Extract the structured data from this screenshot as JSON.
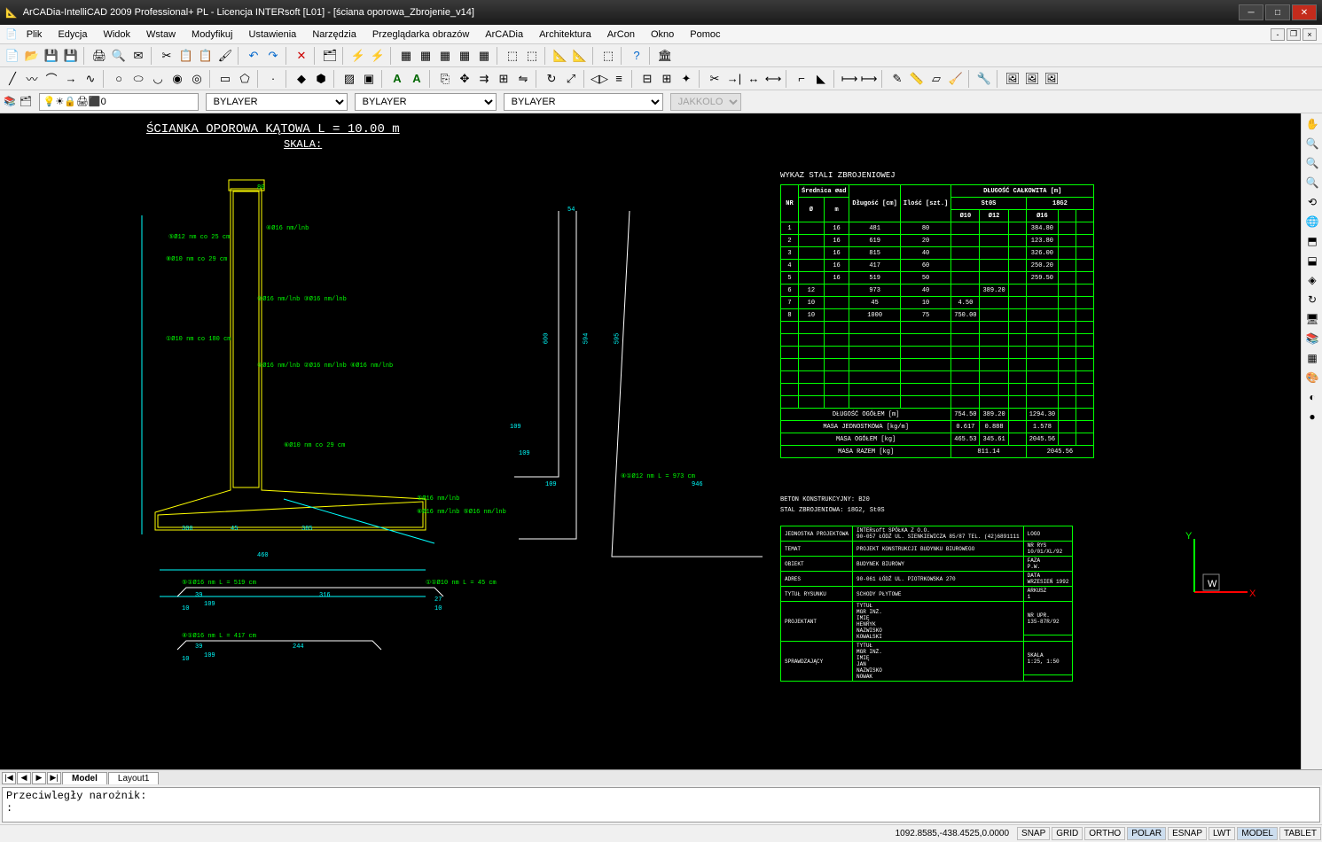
{
  "window": {
    "title": "ArCADia-IntelliCAD 2009 Professional+ PL - Licencja INTERsoft [L01] - [ściana oporowa_Zbrojenie_v14]"
  },
  "menu": [
    "Plik",
    "Edycja",
    "Widok",
    "Wstaw",
    "Modyfikuj",
    "Ustawienia",
    "Narzędzia",
    "Przeglądarka obrazów",
    "ArCADia",
    "Architektura",
    "ArCon",
    "Okno",
    "Pomoc"
  ],
  "layer": {
    "current": "0",
    "linetype": "BYLAYER",
    "lineweight": "BYLAYER",
    "style": "BYLAYER",
    "color_combo": "JAKKOLOR"
  },
  "drawing": {
    "title": "ŚCIANKA OPOROWA KĄTOWA L = 10.00 m",
    "subtitle": "SKALA:",
    "table_title": "WYKAZ STALI ZBROJENIOWEJ",
    "notes": [
      "BETON KONSTRUKCYJNY: B20",
      "STAL ZBROJENIOWA: 18G2, St0S"
    ],
    "annotations": {
      "a1": "④Ø16 nm/lnb",
      "a2": "⑤Ø12 nm co 25 cm",
      "a3": "⑧Ø10 nm co 29 cm",
      "a4": "②Ø16 nm/lnb  ③Ø16 nm/lnb",
      "a5": "①Ø10 nm co 180 cm",
      "a6": "①Ø16 nm/lnb ②Ø16 nm/lnb  ④Ø16 nm/lnb",
      "a7": "⑥Ø10 nm co 29 cm",
      "a8": "⑤Ø16 nm/lnb",
      "a9": "⑥Ø16 nm/lnb  ⑤Ø16 nm/lnb",
      "b1": "⑤①Ø16 nm  L = 519 cm",
      "b2": "④①Ø16 nm  L = 417 cm",
      "b3": "①①Ø10 nm  L = 45 cm",
      "b4": "④①Ø12 nm  L = 973 cm",
      "d1": "300",
      "d2": "45",
      "d3": "385",
      "d4": "460",
      "d5": "109",
      "d6": "10",
      "d7": "316",
      "d8": "39",
      "d9": "244",
      "d10": "600",
      "d11": "594",
      "d12": "595",
      "d13": "54",
      "d14": "946",
      "d15": "27",
      "d16": "80",
      "d17": "109"
    },
    "axes": {
      "y": "Y",
      "w": "W",
      "x": "X"
    }
  },
  "chart_data": {
    "type": "table",
    "title": "WYKAZ STALI ZBROJENIOWEJ",
    "columns": [
      "NR",
      "Średnica ∅ad",
      "Długość [cm]",
      "Ilość [szt.]",
      "St0S Ø10",
      "St0S Ø12",
      "18G2 Ø16",
      "DŁUGOŚĆ CAŁKOWITA [m]"
    ],
    "rows": [
      {
        "nr": "1",
        "dia": "16",
        "len": "481",
        "qty": "80",
        "s10": "",
        "s12": "",
        "g16": "",
        "total": "384.80"
      },
      {
        "nr": "2",
        "dia": "16",
        "len": "619",
        "qty": "20",
        "s10": "",
        "s12": "",
        "g16": "",
        "total": "123.80"
      },
      {
        "nr": "3",
        "dia": "16",
        "len": "815",
        "qty": "40",
        "s10": "",
        "s12": "",
        "g16": "",
        "total": "326.00"
      },
      {
        "nr": "4",
        "dia": "16",
        "len": "417",
        "qty": "60",
        "s10": "",
        "s12": "",
        "g16": "",
        "total": "250.20"
      },
      {
        "nr": "5",
        "dia": "16",
        "len": "519",
        "qty": "50",
        "s10": "",
        "s12": "",
        "g16": "",
        "total": "259.50"
      },
      {
        "nr": "6",
        "dia": "12",
        "len": "973",
        "qty": "40",
        "s10": "",
        "s12": "389.20",
        "g16": "",
        "total": ""
      },
      {
        "nr": "7",
        "dia": "10",
        "len": "45",
        "qty": "10",
        "s10": "4.50",
        "s12": "",
        "g16": "",
        "total": ""
      },
      {
        "nr": "8",
        "dia": "10",
        "len": "1000",
        "qty": "75",
        "s10": "750.00",
        "s12": "",
        "g16": "",
        "total": ""
      }
    ],
    "summary": {
      "dlugosc_ogolem": {
        "label": "DŁUGOŚĆ OGÓŁEM [m]",
        "s10": "754.50",
        "s12": "389.20",
        "g16": "",
        "total": "1294.30"
      },
      "masa_jednostkowa": {
        "label": "MASA JEDNOSTKOWA [kg/m]",
        "s10": "0.617",
        "s12": "0.888",
        "g16": "",
        "total": "1.578"
      },
      "masa_ogolem": {
        "label": "MASA OGÓŁEM [kg]",
        "s10": "465.53",
        "s12": "345.61",
        "g16": "",
        "total": "2045.56"
      },
      "masa_razem": {
        "label": "MASA RAZEM [kg]",
        "st0s": "811.14",
        "g18g2": "2045.56"
      }
    }
  },
  "title_block": {
    "jednostka": {
      "label": "JEDNOSTKA PROJEKTOWA",
      "val": "INTERsoft SPÓŁKA Z O.O.\n90-057 ŁÓDŹ UL. SIENKIEWICZA 85/87 TEL. (42)6891111",
      "logo": "LOGO"
    },
    "temat": {
      "label": "TEMAT",
      "val": "PROJEKT KONSTRUKCJI BUDYNKU BIUROWEGO",
      "nr": "NR RYS",
      "nrv": "10/01/XL/92"
    },
    "obiekt": {
      "label": "OBIEKT",
      "val": "BUDYNEK BIUROWY",
      "f": "FAZA",
      "fv": "P.W."
    },
    "adres": {
      "label": "ADRES",
      "val": "90-061 ŁÓDŹ UL. PIOTRKOWSKA 270",
      "d": "DATA",
      "dv": "WRZESIEŃ 1992"
    },
    "tytul": {
      "label": "TYTUŁ RYSUNKU",
      "val": "SCHODY PŁYTOWE",
      "a": "ARKUSZ",
      "av": "1"
    },
    "projektant": {
      "label": "PROJEKTANT",
      "t": "TYTUŁ\nMGR INŻ.\nIMIĘ\nHENRYK\nNAZWISKO\nKOWALSKI",
      "u": "NR UPR.",
      "uv": "135-87R/92"
    },
    "sprawdzajacy": {
      "label": "SPRAWDZAJĄCY",
      "t": "TYTUŁ\nMGR INŻ.\nIMIĘ\nJAN\nNAZWISKO\nNOWAK",
      "s": "SKALA",
      "sv": "1:25, 1:50"
    }
  },
  "tabs": {
    "model": "Model",
    "layout": "Layout1"
  },
  "command": {
    "line1": "Przeciwległy narożnik:",
    "prompt": ":"
  },
  "status": {
    "coords": "1092.8585,-438.4525,0.0000",
    "toggles": [
      "SNAP",
      "GRID",
      "ORTHO",
      "POLAR",
      "ESNAP",
      "LWT",
      "MODEL",
      "TABLET"
    ],
    "active": [
      "POLAR",
      "MODEL"
    ]
  }
}
